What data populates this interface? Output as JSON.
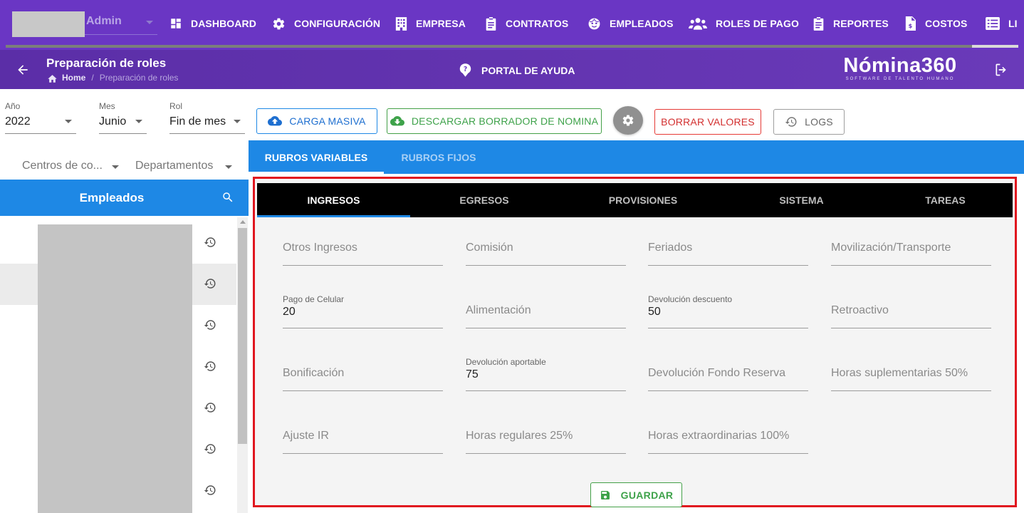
{
  "nav": {
    "user": "Admin",
    "items": [
      {
        "label": "DASHBOARD",
        "icon": "dashboard-icon"
      },
      {
        "label": "CONFIGURACIÓN",
        "icon": "gear-icon"
      },
      {
        "label": "EMPRESA",
        "icon": "building-icon"
      },
      {
        "label": "CONTRATOS",
        "icon": "clipboard-icon"
      },
      {
        "label": "EMPLEADOS",
        "icon": "face-icon"
      },
      {
        "label": "ROLES DE PAGO",
        "icon": "people-icon"
      },
      {
        "label": "REPORTES",
        "icon": "clipboard-icon"
      },
      {
        "label": "COSTOS",
        "icon": "invoice-icon"
      },
      {
        "label": "LI",
        "icon": "list-icon"
      }
    ]
  },
  "header": {
    "title": "Preparación de roles",
    "breadcrumb": {
      "home": "Home",
      "separator": "/",
      "current": "Preparación de roles"
    },
    "help": "PORTAL DE AYUDA",
    "brand": {
      "name": "Nómina360",
      "tagline": "SOFTWARE DE TALENTO HUMANO"
    }
  },
  "filters": {
    "year": {
      "label": "Año",
      "value": "2022"
    },
    "month": {
      "label": "Mes",
      "value": "Junio"
    },
    "role": {
      "label": "Rol",
      "value": "Fin de mes"
    },
    "cost_centers": {
      "placeholder": "Centros de co..."
    },
    "departments": {
      "placeholder": "Departamentos"
    }
  },
  "actions": {
    "bulk_upload": "CARGA MASIVA",
    "download_draft": "DESCARGAR BORRADOR DE NOMINA",
    "clear_values": "BORRAR VALORES",
    "logs": "LOGS"
  },
  "employees": {
    "title": "Empleados",
    "row_count": 7,
    "selected_index": 1
  },
  "tabs": {
    "main": [
      {
        "label": "RUBROS VARIABLES",
        "active": true
      },
      {
        "label": "RUBROS FIJOS",
        "active": false
      }
    ],
    "sub": [
      {
        "label": "INGRESOS",
        "active": true
      },
      {
        "label": "EGRESOS",
        "active": false
      },
      {
        "label": "PROVISIONES",
        "active": false
      },
      {
        "label": "SISTEMA",
        "active": false
      },
      {
        "label": "TAREAS",
        "active": false
      }
    ]
  },
  "fields": [
    {
      "label": "Otros Ingresos",
      "value": ""
    },
    {
      "label": "Comisión",
      "value": ""
    },
    {
      "label": "Feriados",
      "value": ""
    },
    {
      "label": "Movilización/Transporte",
      "value": ""
    },
    {
      "label": "Pago de Celular",
      "value": "20"
    },
    {
      "label": "Alimentación",
      "value": ""
    },
    {
      "label": "Devolución descuento",
      "value": "50"
    },
    {
      "label": "Retroactivo",
      "value": ""
    },
    {
      "label": "Bonificación",
      "value": ""
    },
    {
      "label": "Devolución aportable",
      "value": "75"
    },
    {
      "label": "Devolución Fondo Reserva",
      "value": ""
    },
    {
      "label": "Horas suplementarias 50%",
      "value": ""
    },
    {
      "label": "Ajuste IR",
      "value": ""
    },
    {
      "label": "Horas regulares 25%",
      "value": ""
    },
    {
      "label": "Horas extraordinarias 100%",
      "value": ""
    }
  ],
  "save": "GUARDAR",
  "colors": {
    "primary": "#6a36c4",
    "accent": "#1e88e5",
    "success": "#43a047",
    "danger": "#e53935",
    "highlight": "#e0161f"
  }
}
